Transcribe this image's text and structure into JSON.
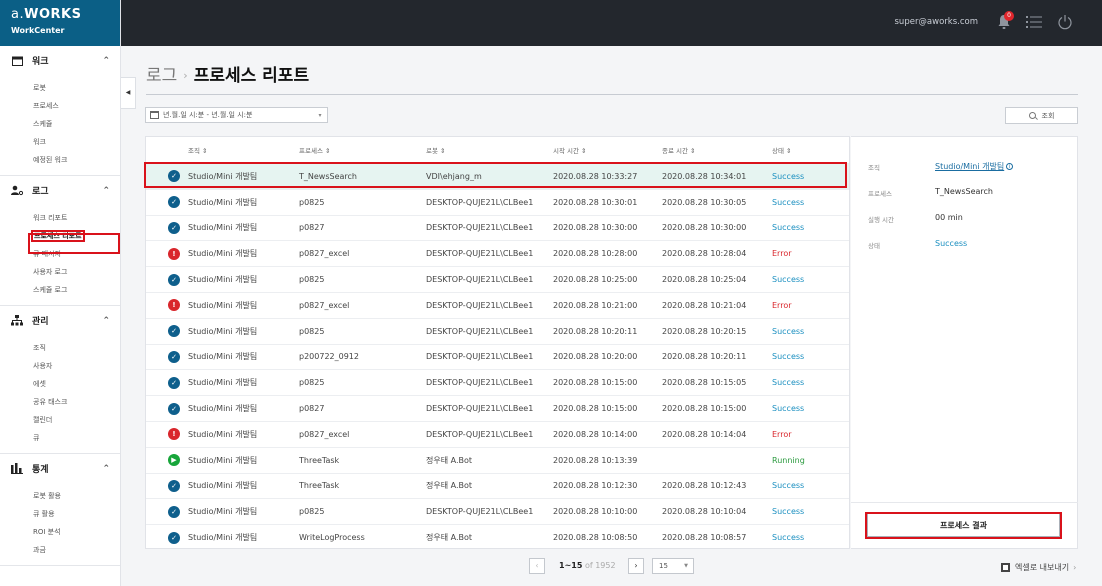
{
  "brand": {
    "logo_a": "a.",
    "logo_b": "WORKS",
    "sub": "WorkCenter"
  },
  "topbar": {
    "user": "super@aworks.com",
    "notifications": "0"
  },
  "sidebar": {
    "sections": [
      {
        "title": "워크",
        "icon": "calendar-icon",
        "items": [
          "로봇",
          "프로세스",
          "스케쥴",
          "워크",
          "예정된 워크"
        ]
      },
      {
        "title": "로그",
        "icon": "user-log-icon",
        "items": [
          "워크 리포트",
          "프로세스 리포트",
          "큐 메시지",
          "사용자 로그",
          "스케쥴 로그"
        ],
        "active": "프로세스 리포트"
      },
      {
        "title": "관리",
        "icon": "org-icon",
        "items": [
          "조직",
          "사용자",
          "에셋",
          "공유 태스크",
          "캘린더",
          "큐"
        ]
      },
      {
        "title": "통계",
        "icon": "chart-icon",
        "items": [
          "로봇 활용",
          "큐 활용",
          "ROI 분석",
          "과금"
        ]
      }
    ]
  },
  "header": {
    "crumb_parent": "로그",
    "crumb_sep": "›",
    "title": "프로세스 리포트"
  },
  "filter": {
    "date_placeholder": "년.월.일 시:분 - 년.월.일 시:분",
    "search_label": "조회"
  },
  "table": {
    "columns": [
      "조직 ⇕",
      "프로세스 ⇕",
      "로봇 ⇕",
      "시작 시간 ⇕",
      "종료 시간 ⇕",
      "상태 ⇕"
    ],
    "rows": [
      {
        "status": "success",
        "org": "Studio/Mini 개발팀",
        "process": "T_NewsSearch",
        "robot": "VDI\\ehjang_m",
        "start": "2020.08.28 10:33:27",
        "end": "2020.08.28 10:34:01",
        "state": "Success"
      },
      {
        "status": "success",
        "org": "Studio/Mini 개발팀",
        "process": "p0825",
        "robot": "DESKTOP-QUJE21L\\CLBee1",
        "start": "2020.08.28 10:30:01",
        "end": "2020.08.28 10:30:05",
        "state": "Success"
      },
      {
        "status": "success",
        "org": "Studio/Mini 개발팀",
        "process": "p0827",
        "robot": "DESKTOP-QUJE21L\\CLBee1",
        "start": "2020.08.28 10:30:00",
        "end": "2020.08.28 10:30:00",
        "state": "Success"
      },
      {
        "status": "error",
        "org": "Studio/Mini 개발팀",
        "process": "p0827_excel",
        "robot": "DESKTOP-QUJE21L\\CLBee1",
        "start": "2020.08.28 10:28:00",
        "end": "2020.08.28 10:28:04",
        "state": "Error"
      },
      {
        "status": "success",
        "org": "Studio/Mini 개발팀",
        "process": "p0825",
        "robot": "DESKTOP-QUJE21L\\CLBee1",
        "start": "2020.08.28 10:25:00",
        "end": "2020.08.28 10:25:04",
        "state": "Success"
      },
      {
        "status": "error",
        "org": "Studio/Mini 개발팀",
        "process": "p0827_excel",
        "robot": "DESKTOP-QUJE21L\\CLBee1",
        "start": "2020.08.28 10:21:00",
        "end": "2020.08.28 10:21:04",
        "state": "Error"
      },
      {
        "status": "success",
        "org": "Studio/Mini 개발팀",
        "process": "p0825",
        "robot": "DESKTOP-QUJE21L\\CLBee1",
        "start": "2020.08.28 10:20:11",
        "end": "2020.08.28 10:20:15",
        "state": "Success"
      },
      {
        "status": "success",
        "org": "Studio/Mini 개발팀",
        "process": "p200722_0912",
        "robot": "DESKTOP-QUJE21L\\CLBee1",
        "start": "2020.08.28 10:20:00",
        "end": "2020.08.28 10:20:11",
        "state": "Success"
      },
      {
        "status": "success",
        "org": "Studio/Mini 개발팀",
        "process": "p0825",
        "robot": "DESKTOP-QUJE21L\\CLBee1",
        "start": "2020.08.28 10:15:00",
        "end": "2020.08.28 10:15:05",
        "state": "Success"
      },
      {
        "status": "success",
        "org": "Studio/Mini 개발팀",
        "process": "p0827",
        "robot": "DESKTOP-QUJE21L\\CLBee1",
        "start": "2020.08.28 10:15:00",
        "end": "2020.08.28 10:15:00",
        "state": "Success"
      },
      {
        "status": "error",
        "org": "Studio/Mini 개발팀",
        "process": "p0827_excel",
        "robot": "DESKTOP-QUJE21L\\CLBee1",
        "start": "2020.08.28 10:14:00",
        "end": "2020.08.28 10:14:04",
        "state": "Error"
      },
      {
        "status": "running",
        "org": "Studio/Mini 개발팀",
        "process": "ThreeTask",
        "robot": "정우태 A.Bot",
        "start": "2020.08.28 10:13:39",
        "end": "",
        "state": "Running"
      },
      {
        "status": "success",
        "org": "Studio/Mini 개발팀",
        "process": "ThreeTask",
        "robot": "정우태 A.Bot",
        "start": "2020.08.28 10:12:30",
        "end": "2020.08.28 10:12:43",
        "state": "Success"
      },
      {
        "status": "success",
        "org": "Studio/Mini 개발팀",
        "process": "p0825",
        "robot": "DESKTOP-QUJE21L\\CLBee1",
        "start": "2020.08.28 10:10:00",
        "end": "2020.08.28 10:10:04",
        "state": "Success"
      },
      {
        "status": "success",
        "org": "Studio/Mini 개발팀",
        "process": "WriteLogProcess",
        "robot": "정우태 A.Bot",
        "start": "2020.08.28 10:08:50",
        "end": "2020.08.28 10:08:57",
        "state": "Success"
      }
    ]
  },
  "detail": {
    "org_label": "조직",
    "org_value": "Studio/Mini 개발팀",
    "process_label": "프로세스",
    "process_value": "T_NewsSearch",
    "runtime_label": "실행 시간",
    "runtime_value": "00 min",
    "state_label": "상태",
    "state_value": "Success",
    "result_button": "프로세스 결과"
  },
  "pagination": {
    "range": "1~15",
    "of": "of 1952",
    "page_size": "15",
    "prev": "‹",
    "next": "›"
  },
  "export": {
    "label": "엑셀로 내보내기",
    "chevron": "›"
  },
  "colors": {
    "brand": "#0b5f86",
    "topbar": "#23272d",
    "success": "#1a8fc0",
    "error": "#d9262c",
    "running": "#2a9a3e",
    "highlight": "#d9121b"
  }
}
